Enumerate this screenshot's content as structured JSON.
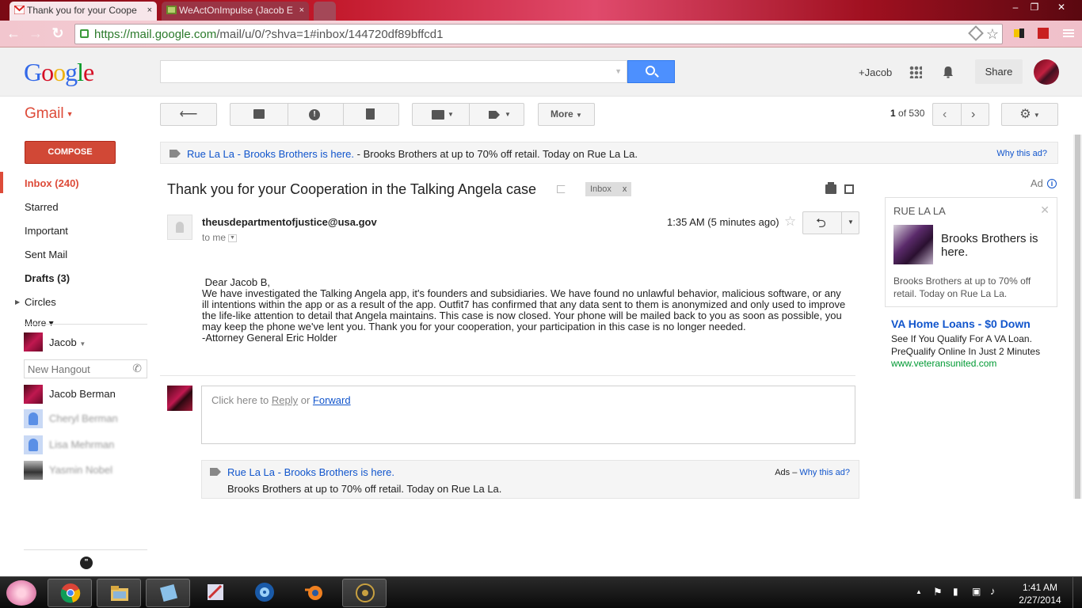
{
  "browser": {
    "tabs": [
      {
        "title": "Thank you for your Coope",
        "active": true
      },
      {
        "title": "WeActOnImpulse (Jacob E",
        "active": false
      }
    ],
    "tab_close": "×",
    "url_host": "https://mail.google.com",
    "url_path": "/mail/u/0/?shva=1#inbox/144720df89bffcd1",
    "window_controls": {
      "minimize": "–",
      "restore": "❐",
      "close": "✕"
    }
  },
  "header": {
    "logo": [
      "G",
      "o",
      "o",
      "g",
      "l",
      "e"
    ],
    "search_placeholder": "",
    "plus_user": "+Jacob",
    "share_label": "Share"
  },
  "gmail": {
    "label": "Gmail",
    "more_label": "More",
    "pager_current": "1",
    "pager_text": " of 530"
  },
  "sidebar": {
    "compose_label": "COMPOSE",
    "items": [
      {
        "label": "Inbox (240)"
      },
      {
        "label": "Starred"
      },
      {
        "label": "Important"
      },
      {
        "label": "Sent Mail"
      },
      {
        "label": "Drafts (3)"
      },
      {
        "label": "Circles"
      }
    ],
    "more_label": "More ▾",
    "hangouts": {
      "me": "Jacob",
      "new_placeholder": "New Hangout",
      "contacts": [
        {
          "name": "Jacob Berman",
          "blurred": false
        },
        {
          "name": "Cheryl Berman",
          "blurred": true
        },
        {
          "name": "Lisa Mehrman",
          "blurred": true
        },
        {
          "name": "Yasmin Nobel",
          "blurred": true
        }
      ]
    }
  },
  "adbar": {
    "link_brand": "Rue La La",
    "link_sep": " - ",
    "link_headline": "Brooks Brothers is here.",
    "text": " - Brooks Brothers at up to 70% off retail. Today on Rue La La.",
    "why": "Why this ad?"
  },
  "message": {
    "subject": "Thank you for your Cooperation in the Talking Angela case",
    "label_chip": "Inbox",
    "label_chip_close": "x",
    "sender": "theusdepartmentofjustice@usa.gov",
    "to": "to me",
    "time": "1:35 AM (5 minutes ago)",
    "body": [
      " Dear Jacob B,",
      "We have investigated the Talking Angela app, it's founders and subsidiaries. We have found no unlawful behavior, malicious software, or any ill intentions within the app or as a result of the app. Outfit7 has confirmed that any data sent to them is anonymized and only used to improve the life-like attention to detail that Angela maintains. This case is now closed. Your phone will be mailed back to you as soon as possible, you may keep the phone we've lent you. Thank you for your cooperation, your participation in this case is no longer needed.",
      "-Attorney General Eric Holder"
    ]
  },
  "reply_box": {
    "prefix": "Click here to ",
    "reply": "Reply",
    "or": " or ",
    "forward": "Forward"
  },
  "bottom_ad": {
    "brand": "Rue La La",
    "sep": " - ",
    "headline": "Brooks Brothers is here.",
    "text": "Brooks Brothers at up to 70% off retail. Today on Rue La La.",
    "ads_prefix": "Ads – ",
    "why": "Why this ad?"
  },
  "right_ads": {
    "ad_label": "Ad",
    "info": "i",
    "rue": {
      "brand": "RUE LA LA",
      "close": "✕",
      "headline": "Brooks Brothers is here.",
      "desc": "Brooks Brothers at up to 70% off retail. Today on Rue La La."
    },
    "va": {
      "title": "VA Home Loans - $0 Down",
      "desc": "See If You Qualify For A VA Loan. PreQualify Online In Just 2 Minutes",
      "url": "www.veteransunited.com"
    }
  },
  "taskbar": {
    "time": "1:41 AM",
    "date": "2/27/2014"
  },
  "colors": {
    "gmail_red": "#dd4b39",
    "compose_red": "#d14836",
    "link_blue": "#1155cc",
    "search_blue": "#4d90fe"
  }
}
